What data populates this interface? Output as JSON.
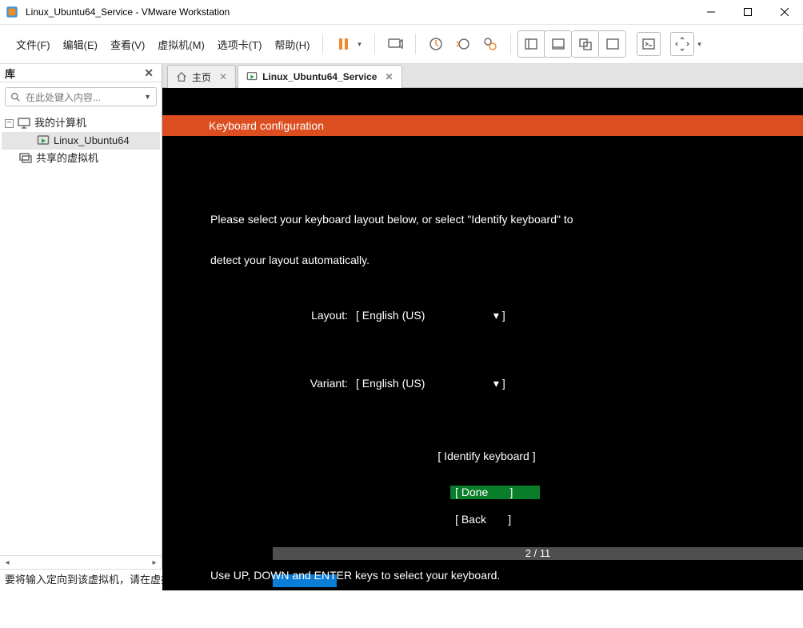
{
  "window": {
    "title": "Linux_Ubuntu64_Service - VMware Workstation"
  },
  "menus": {
    "file": "文件(F)",
    "edit": "编辑(E)",
    "view": "查看(V)",
    "vm": "虚拟机(M)",
    "tabs": "选项卡(T)",
    "help": "帮助(H)"
  },
  "library": {
    "title": "库",
    "search_placeholder": "在此处键入内容...",
    "items": {
      "my_computer": "我的计算机",
      "vm1": "Linux_Ubuntu64",
      "shared": "共享的虚拟机"
    }
  },
  "tabs": {
    "home": "主页",
    "vm": "Linux_Ubuntu64_Service"
  },
  "installer": {
    "header": "Keyboard configuration",
    "prompt_l1": "Please select your keyboard layout below, or select \"Identify keyboard\" to",
    "prompt_l2": "detect your layout automatically.",
    "layout_label": "Layout:",
    "layout_value": "[ English (US)                      ▾ ]",
    "variant_label": "Variant:",
    "variant_value": "[ English (US)                      ▾ ]",
    "identify": "[ Identify keyboard ]",
    "done": "[ Done       ]",
    "back": "[ Back       ]",
    "progress": "2 / 11",
    "hint": "Use UP, DOWN and ENTER keys to select your keyboard."
  },
  "status": {
    "text": "要将输入定向到该虚拟机，请在虚拟机内部单击或按 Ctrl+G。"
  }
}
